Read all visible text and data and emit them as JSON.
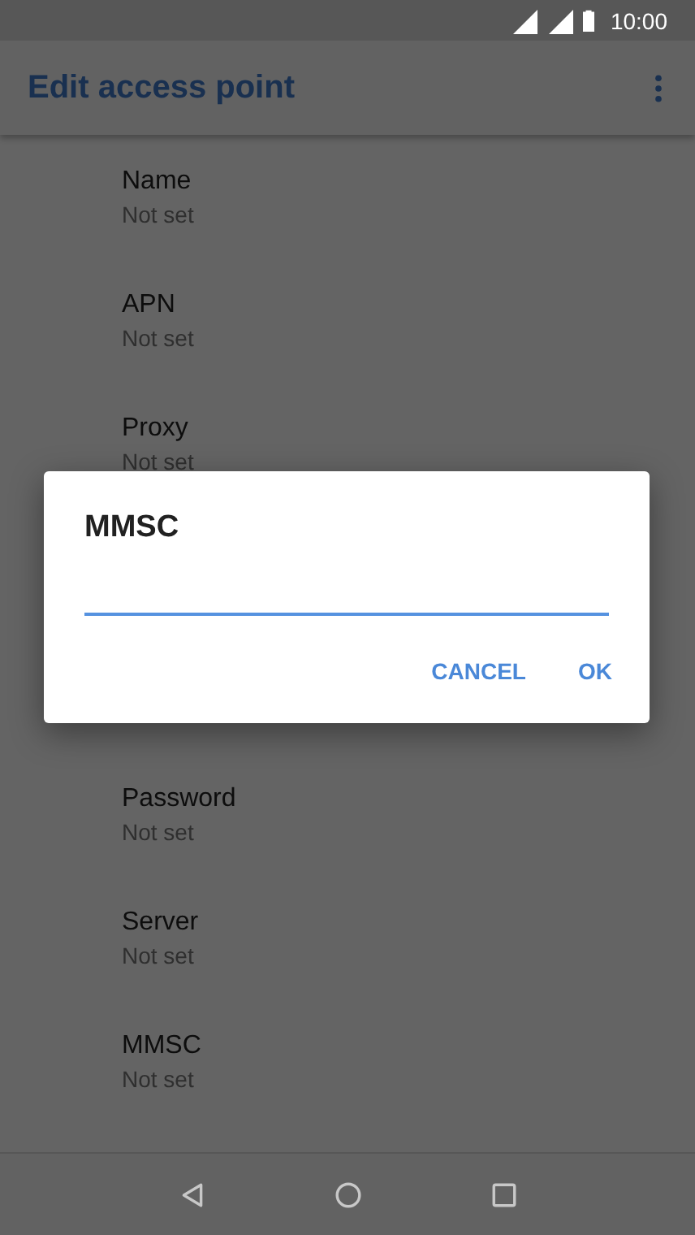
{
  "status_bar": {
    "time": "10:00"
  },
  "app_bar": {
    "title": "Edit access point"
  },
  "settings": [
    {
      "title": "Name",
      "summary": "Not set"
    },
    {
      "title": "APN",
      "summary": "Not set"
    },
    {
      "title": "Proxy",
      "summary": "Not set"
    }
  ],
  "settings_below_dialog": [
    {
      "title": "Password",
      "summary": "Not set"
    },
    {
      "title": "Server",
      "summary": "Not set"
    },
    {
      "title": "MMSC",
      "summary": "Not set"
    }
  ],
  "dialog": {
    "title": "MMSC",
    "field": {
      "focused": true
    },
    "buttons": [
      "CANCEL",
      "OK"
    ]
  }
}
